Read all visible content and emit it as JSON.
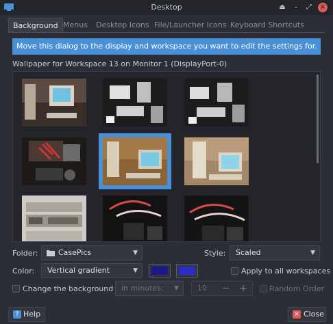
{
  "window": {
    "title": "Desktop"
  },
  "tabs": [
    "Background",
    "Menus",
    "Desktop Icons",
    "File/Launcher Icons",
    "Keyboard Shortcuts"
  ],
  "banner": "Move this dialog to the display and workspace you want to edit the settings for.",
  "wallpaper_label": "Wallpaper for Workspace 13 on Monitor 1 (DisplayPort-0)",
  "folder": {
    "label": "Folder:",
    "value": "CasePics"
  },
  "style": {
    "label": "Style:",
    "value": "Scaled"
  },
  "color": {
    "label": "Color:",
    "value": "Vertical gradient",
    "primary": "#1a1a8c",
    "secondary": "#2c2cc8"
  },
  "apply_all": {
    "label": "Apply to all workspaces",
    "checked": false
  },
  "change_bg": {
    "label": "Change the background",
    "checked": false
  },
  "interval": {
    "unit": "in minutes:",
    "value": "10"
  },
  "random": {
    "label": "Random Order",
    "checked": false
  },
  "buttons": {
    "help": "Help",
    "close": "Close"
  },
  "colors": {
    "accent": "#4a90d9",
    "close_btn": "#e0585b"
  }
}
